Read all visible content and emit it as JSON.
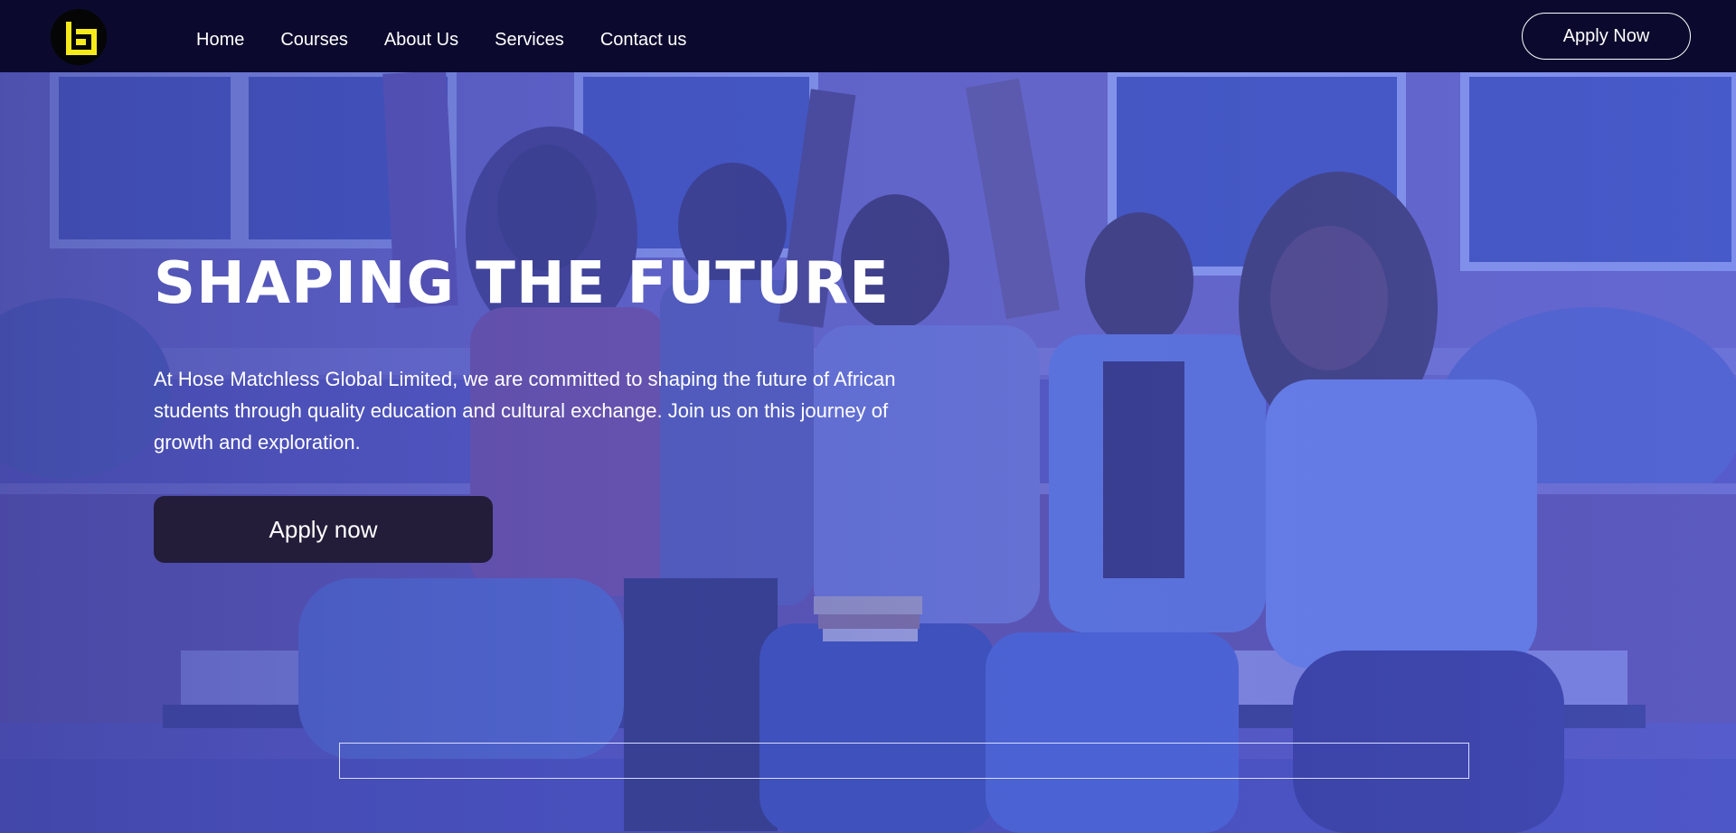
{
  "brand": {
    "logo_icon": "brand-logo-icon",
    "logo_color": "#f7ea1b",
    "logo_bg": "#050505"
  },
  "nav": {
    "items": [
      "Home",
      "Courses",
      "About Us",
      "Services",
      "Contact us"
    ],
    "apply_label": "Apply Now"
  },
  "hero": {
    "title": "SHAPING THE FUTURE",
    "description": "At Hose Matchless Global Limited, we are committed to shaping the future of African students through quality education and cultural exchange. Join us on this journey of growth and exploration.",
    "cta_label": "Apply now",
    "image_subject": "students-on-bench-photo",
    "overlay_color": "#4a5ce0"
  },
  "colors": {
    "nav_bg": "#0b0a2e",
    "cta_bg": "#231d3a",
    "text": "#ffffff"
  }
}
